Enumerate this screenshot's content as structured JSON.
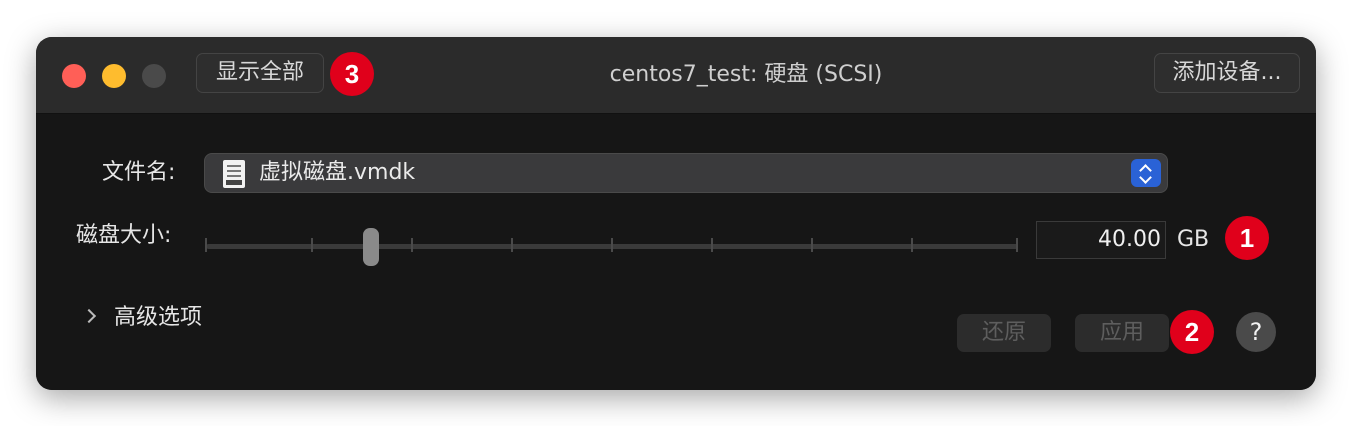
{
  "window": {
    "title": "centos7_test: 硬盘 (SCSI)",
    "show_all_label": "显示全部",
    "add_device_label": "添加设备..."
  },
  "form": {
    "filename_label": "文件名:",
    "filename_value": "虚拟磁盘.vmdk",
    "disk_size_label": "磁盘大小:",
    "disk_size_value": "40.00",
    "disk_size_unit": "GB",
    "advanced_label": "高级选项"
  },
  "buttons": {
    "revert_label": "还原",
    "apply_label": "应用",
    "help_label": "?"
  },
  "annotations": {
    "badge_1": "1",
    "badge_2": "2",
    "badge_3": "3"
  },
  "colors": {
    "badge": "#e0001b",
    "stepper_accent": "#2a62d6"
  }
}
